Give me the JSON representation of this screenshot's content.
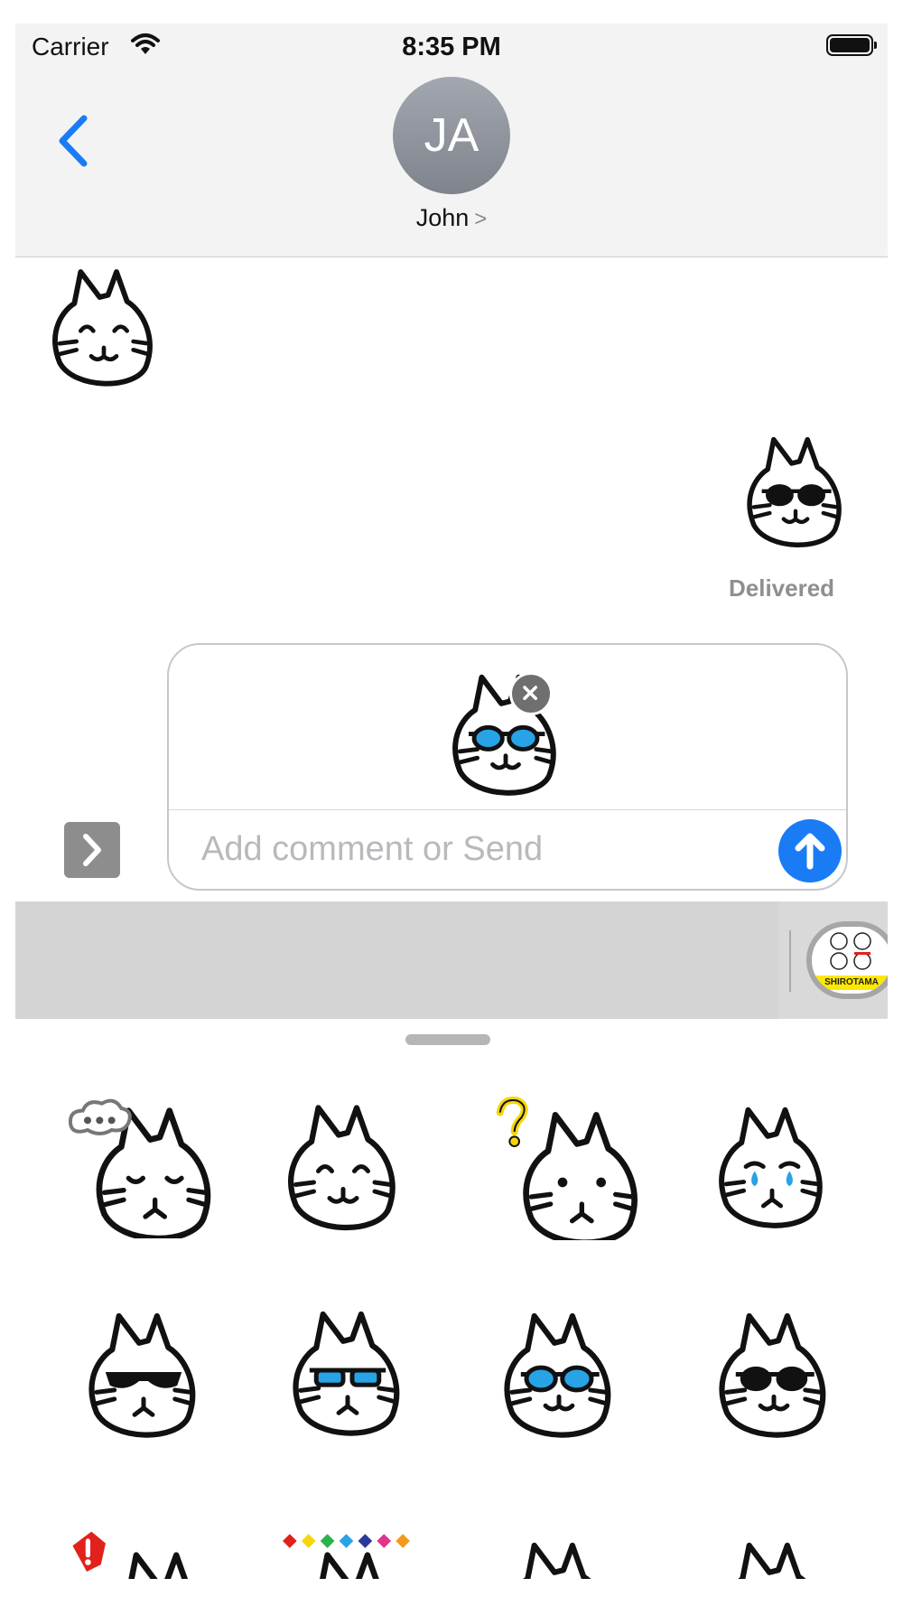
{
  "status_bar": {
    "carrier": "Carrier",
    "time": "8:35 PM"
  },
  "header": {
    "avatar_initials": "JA",
    "contact_name": "John",
    "contact_chevron": ">"
  },
  "messages": {
    "delivered_label": "Delivered"
  },
  "compose": {
    "placeholder": "Add comment or Send"
  },
  "app_tray": {
    "app_label": "SHIROTAMA"
  },
  "colors": {
    "accent_blue": "#1a7cf5",
    "header_bg": "#f3f3f3",
    "tray_bg": "#d9d9d9",
    "tear_blue": "#27a3e6",
    "question_yellow": "#f6d60a",
    "alert_red": "#e2211c"
  },
  "sticker_grid": [
    "cat-thinking-sticker",
    "cat-smiling-sticker",
    "cat-confused-sticker",
    "cat-crying-sticker",
    "cat-black-sunglasses-sticker",
    "cat-blue-sunglasses-sticker",
    "cat-round-blue-glasses-sticker",
    "cat-round-black-glasses-sticker",
    "cat-surprised-sticker",
    "cat-rainbow-party-sticker",
    "cat-blushing-sticker",
    "cat-happy-sticker"
  ]
}
